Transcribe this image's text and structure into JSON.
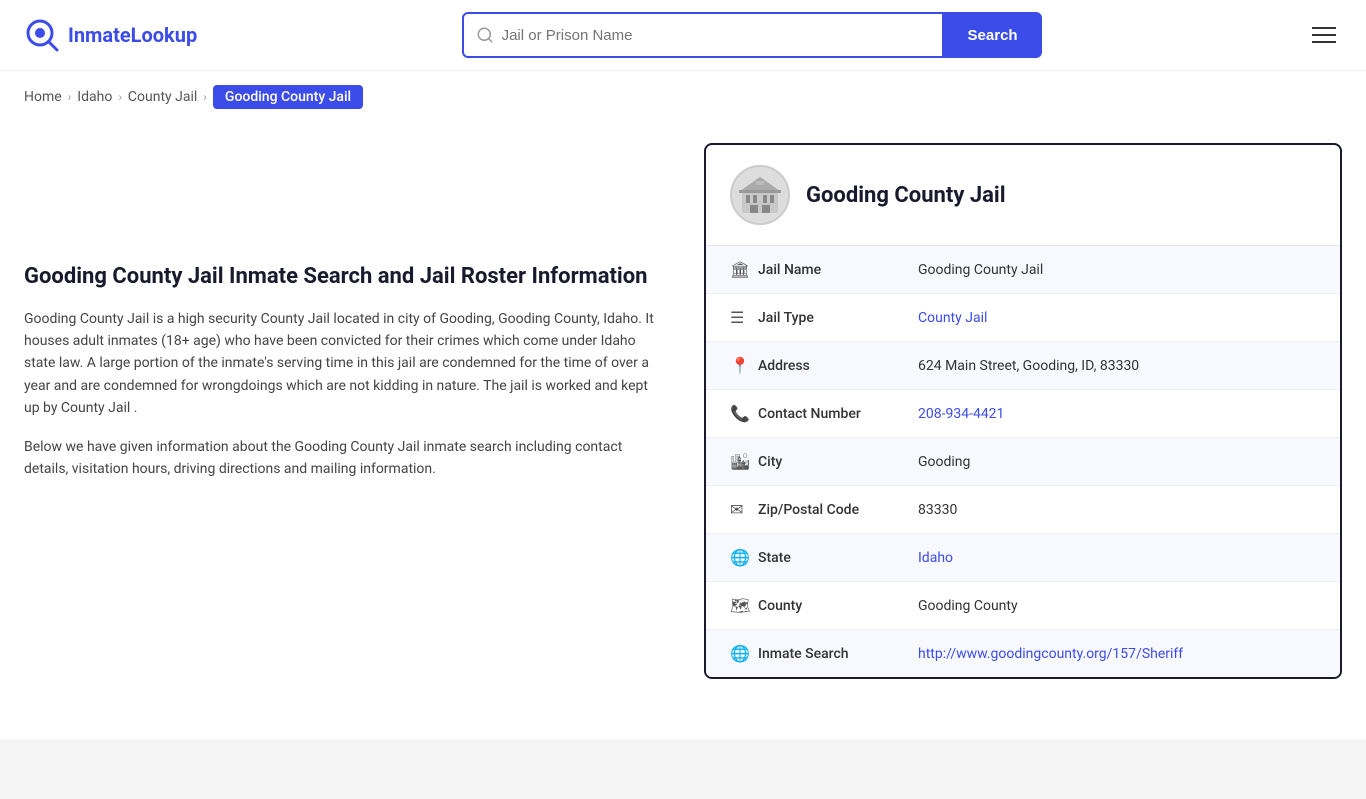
{
  "header": {
    "logo_text_part1": "Inmate",
    "logo_text_part2": "Lookup",
    "search_placeholder": "Jail or Prison Name",
    "search_button_label": "Search",
    "menu_icon": "hamburger-icon"
  },
  "breadcrumb": {
    "items": [
      {
        "label": "Home",
        "href": "#"
      },
      {
        "label": "Idaho",
        "href": "#"
      },
      {
        "label": "County Jail",
        "href": "#"
      },
      {
        "label": "Gooding County Jail",
        "active": true
      }
    ]
  },
  "left": {
    "heading": "Gooding County Jail Inmate Search and Jail Roster Information",
    "para1": "Gooding County Jail is a high security County Jail located in city of Gooding, Gooding County, Idaho. It houses adult inmates (18+ age) who have been convicted for their crimes which come under Idaho state law. A large portion of the inmate's serving time in this jail are condemned for the time of over a year and are condemned for wrongdoings which are not kidding in nature. The jail is worked and kept up by County Jail .",
    "para2": "Below we have given information about the Gooding County Jail inmate search including contact details, visitation hours, driving directions and mailing information."
  },
  "card": {
    "title": "Gooding County Jail",
    "rows": [
      {
        "icon": "jail-icon",
        "label": "Jail Name",
        "value": "Gooding County Jail",
        "link": null
      },
      {
        "icon": "type-icon",
        "label": "Jail Type",
        "value": "County Jail",
        "link": "#"
      },
      {
        "icon": "location-icon",
        "label": "Address",
        "value": "624 Main Street, Gooding, ID, 83330",
        "link": null
      },
      {
        "icon": "phone-icon",
        "label": "Contact Number",
        "value": "208-934-4421",
        "link": "tel:208-934-4421"
      },
      {
        "icon": "city-icon",
        "label": "City",
        "value": "Gooding",
        "link": null
      },
      {
        "icon": "zip-icon",
        "label": "Zip/Postal Code",
        "value": "83330",
        "link": null
      },
      {
        "icon": "state-icon",
        "label": "State",
        "value": "Idaho",
        "link": "#"
      },
      {
        "icon": "county-icon",
        "label": "County",
        "value": "Gooding County",
        "link": null
      },
      {
        "icon": "web-icon",
        "label": "Inmate Search",
        "value": "http://www.goodingcounty.org/157/Sheriff",
        "link": "http://www.goodingcounty.org/157/Sheriff"
      }
    ]
  }
}
